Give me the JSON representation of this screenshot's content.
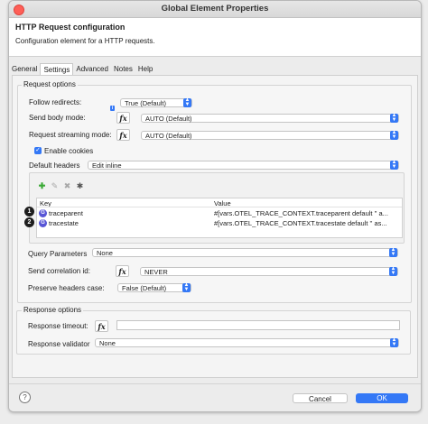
{
  "window": {
    "title": "Global Element Properties"
  },
  "header": {
    "title": "HTTP Request configuration",
    "subtitle": "Configuration element for a HTTP requests."
  },
  "tabs": [
    "General",
    "Settings",
    "Advanced",
    "Notes",
    "Help"
  ],
  "request_options": {
    "title": "Request options",
    "follow_redirects": {
      "label": "Follow redirects:",
      "value": "True (Default)"
    },
    "send_body_mode": {
      "label": "Send body mode:",
      "value": "AUTO (Default)"
    },
    "request_streaming_mode": {
      "label": "Request streaming mode:",
      "value": "AUTO (Default)"
    },
    "enable_cookies": {
      "label": "Enable cookies",
      "checked": true
    },
    "default_headers": {
      "label": "Default headers",
      "value": "Edit inline"
    },
    "table": {
      "columns": [
        "Key",
        "Value"
      ],
      "rows": [
        {
          "badge": "1",
          "key": "traceparent",
          "value": "#[vars.OTEL_TRACE_CONTEXT.traceparent default '' a..."
        },
        {
          "badge": "2",
          "key": "tracestate",
          "value": "#[vars.OTEL_TRACE_CONTEXT.tracestate default '' as..."
        }
      ]
    },
    "query_parameters": {
      "label": "Query Parameters",
      "value": "None"
    },
    "send_correlation_id": {
      "label": "Send correlation id:",
      "value": "NEVER"
    },
    "preserve_headers_case": {
      "label": "Preserve headers case:",
      "value": "False (Default)"
    }
  },
  "response_options": {
    "title": "Response options",
    "response_timeout": {
      "label": "Response timeout:",
      "value": ""
    },
    "response_validator": {
      "label": "Response validator",
      "value": "None"
    }
  },
  "fx_label": "fx",
  "buttons": {
    "cancel": "Cancel",
    "ok": "OK",
    "help": "?"
  },
  "colors": {
    "accent": "#3478f6",
    "close": "#fe5f57"
  }
}
